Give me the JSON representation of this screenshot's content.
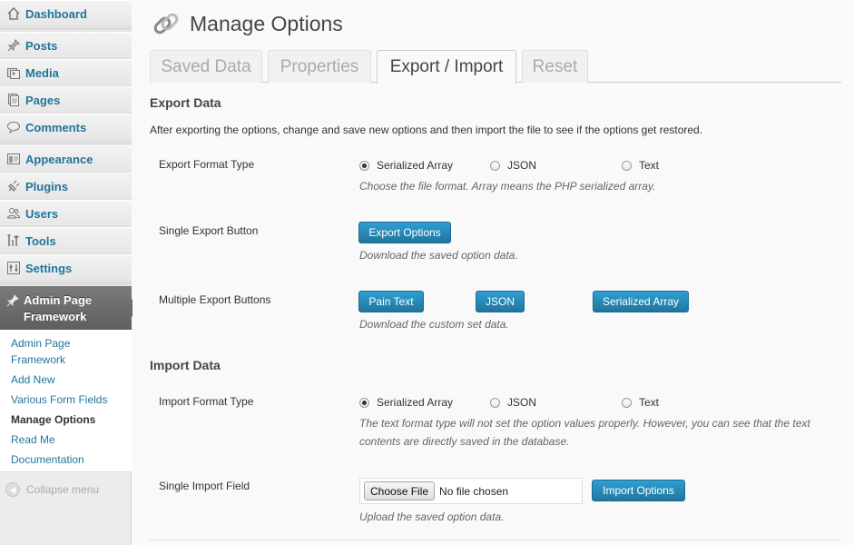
{
  "sidebar": {
    "items": [
      {
        "label": "Dashboard",
        "icon": "dashboard-icon"
      },
      {
        "label": "Posts",
        "icon": "pin-icon"
      },
      {
        "label": "Media",
        "icon": "media-icon"
      },
      {
        "label": "Pages",
        "icon": "pages-icon"
      },
      {
        "label": "Comments",
        "icon": "comment-icon"
      },
      {
        "label": "Appearance",
        "icon": "appearance-icon"
      },
      {
        "label": "Plugins",
        "icon": "plugin-icon"
      },
      {
        "label": "Users",
        "icon": "users-icon"
      },
      {
        "label": "Tools",
        "icon": "tools-icon"
      },
      {
        "label": "Settings",
        "icon": "settings-icon"
      }
    ],
    "current": {
      "label_line1": "Admin Page",
      "label_line2": "Framework",
      "icon": "pin-icon"
    },
    "submenu": [
      {
        "label": "Admin Page Framework"
      },
      {
        "label": "Add New"
      },
      {
        "label": "Various Form Fields"
      },
      {
        "label": "Manage Options"
      },
      {
        "label": "Read Me"
      },
      {
        "label": "Documentation"
      }
    ],
    "collapse_label": "Collapse menu"
  },
  "page": {
    "title": "Manage Options",
    "icon": "link-icon",
    "tabs": [
      {
        "label": "Saved Data"
      },
      {
        "label": "Properties"
      },
      {
        "label": "Export / Import",
        "active": true
      },
      {
        "label": "Reset"
      }
    ]
  },
  "export": {
    "title": "Export Data",
    "description": "After exporting the options, change and save new options and then import the file to see if the options get restored.",
    "format_label": "Export Format Type",
    "format_options": [
      "Serialized Array",
      "JSON",
      "Text"
    ],
    "format_selected": "Serialized Array",
    "format_help": "Choose the file format. Array means the PHP serialized array.",
    "single_label": "Single Export Button",
    "single_button": "Export Options",
    "single_help": "Download the saved option data.",
    "multiple_label": "Multiple Export Buttons",
    "multiple_buttons": [
      "Pain Text",
      "JSON",
      "Serialized Array"
    ],
    "multiple_help": "Download the custom set data."
  },
  "import": {
    "title": "Import Data",
    "format_label": "Import Format Type",
    "format_options": [
      "Serialized Array",
      "JSON",
      "Text"
    ],
    "format_selected": "Serialized Array",
    "format_help_line1": "The text format type will not set the option values properly. However, you can see that the text",
    "format_help_line2": "contents are directly saved in the database.",
    "field_label": "Single Import Field",
    "choose_file": "Choose File",
    "no_file": "No file chosen",
    "import_button": "Import Options",
    "field_help": "Upload the saved option data."
  },
  "colors": {
    "link": "#21759b",
    "button": "#21759b",
    "current_menu": "#6d6d6d"
  }
}
